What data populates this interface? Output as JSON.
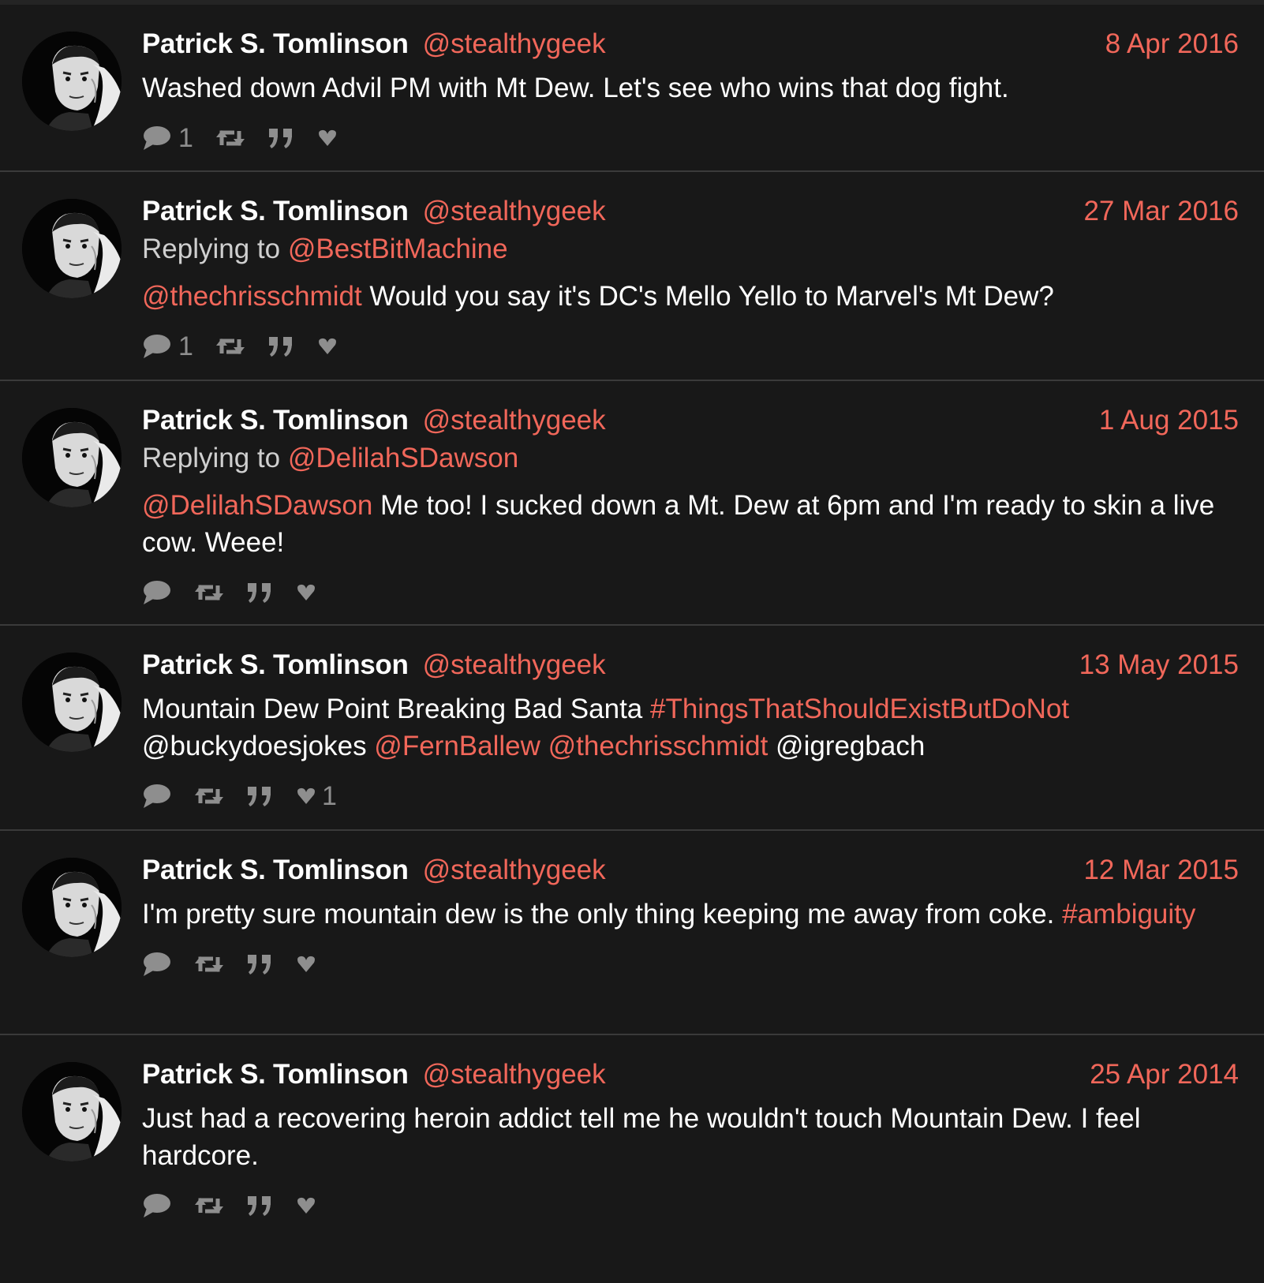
{
  "tweets": [
    {
      "name": "Patrick S. Tomlinson",
      "handle": "@stealthygeek",
      "date": "8 Apr 2016",
      "reply_label": "",
      "reply_to": "",
      "segments": [
        {
          "text": "Washed down Advil PM with Mt Dew. Let's see who wins that dog fight.",
          "link": false
        }
      ],
      "reply_count": "1",
      "like_count": ""
    },
    {
      "name": "Patrick S. Tomlinson",
      "handle": "@stealthygeek",
      "date": "27 Mar 2016",
      "reply_label": "Replying to",
      "reply_to": "@BestBitMachine",
      "segments": [
        {
          "text": "@thechrisschmidt",
          "link": true
        },
        {
          "text": " Would you say it's DC's Mello Yello to Marvel's Mt Dew?",
          "link": false
        }
      ],
      "reply_count": "1",
      "like_count": ""
    },
    {
      "name": "Patrick S. Tomlinson",
      "handle": "@stealthygeek",
      "date": "1 Aug 2015",
      "reply_label": "Replying to",
      "reply_to": "@DelilahSDawson",
      "segments": [
        {
          "text": "@DelilahSDawson",
          "link": true
        },
        {
          "text": " Me too! I sucked down a Mt. Dew at 6pm and I'm ready to skin a live cow. Weee!",
          "link": false
        }
      ],
      "reply_count": "",
      "like_count": ""
    },
    {
      "name": "Patrick S. Tomlinson",
      "handle": "@stealthygeek",
      "date": "13 May 2015",
      "reply_label": "",
      "reply_to": "",
      "segments": [
        {
          "text": "Mountain Dew Point Breaking Bad Santa ",
          "link": false
        },
        {
          "text": "#ThingsThatShouldExistButDoNot",
          "link": true
        },
        {
          "text": " @buckydoesjokes ",
          "link": false
        },
        {
          "text": "@FernBallew",
          "link": true
        },
        {
          "text": " ",
          "link": false
        },
        {
          "text": "@thechrisschmidt",
          "link": true
        },
        {
          "text": " @igregbach",
          "link": false
        }
      ],
      "reply_count": "",
      "like_count": "1"
    },
    {
      "name": "Patrick S. Tomlinson",
      "handle": "@stealthygeek",
      "date": "12 Mar 2015",
      "reply_label": "",
      "reply_to": "",
      "segments": [
        {
          "text": "I'm pretty sure mountain dew is the only thing keeping me away from coke. ",
          "link": false
        },
        {
          "text": "#ambiguity",
          "link": true
        }
      ],
      "reply_count": "",
      "like_count": ""
    },
    {
      "name": "Patrick S. Tomlinson",
      "handle": "@stealthygeek",
      "date": "25 Apr 2014",
      "reply_label": "",
      "reply_to": "",
      "segments": [
        {
          "text": "Just had a recovering heroin addict tell me he wouldn't touch Mountain Dew. I feel hardcore.",
          "link": false
        }
      ],
      "reply_count": "",
      "like_count": ""
    }
  ],
  "icons": {
    "reply": "speech-bubble-icon",
    "retweet": "retweet-icon",
    "quote": "quote-icon",
    "like": "heart-icon"
  },
  "colors": {
    "background": "#181818",
    "accent": "#f1675a",
    "text": "#ffffff",
    "muted": "#8e8e8e",
    "divider": "#3a3a3a"
  }
}
